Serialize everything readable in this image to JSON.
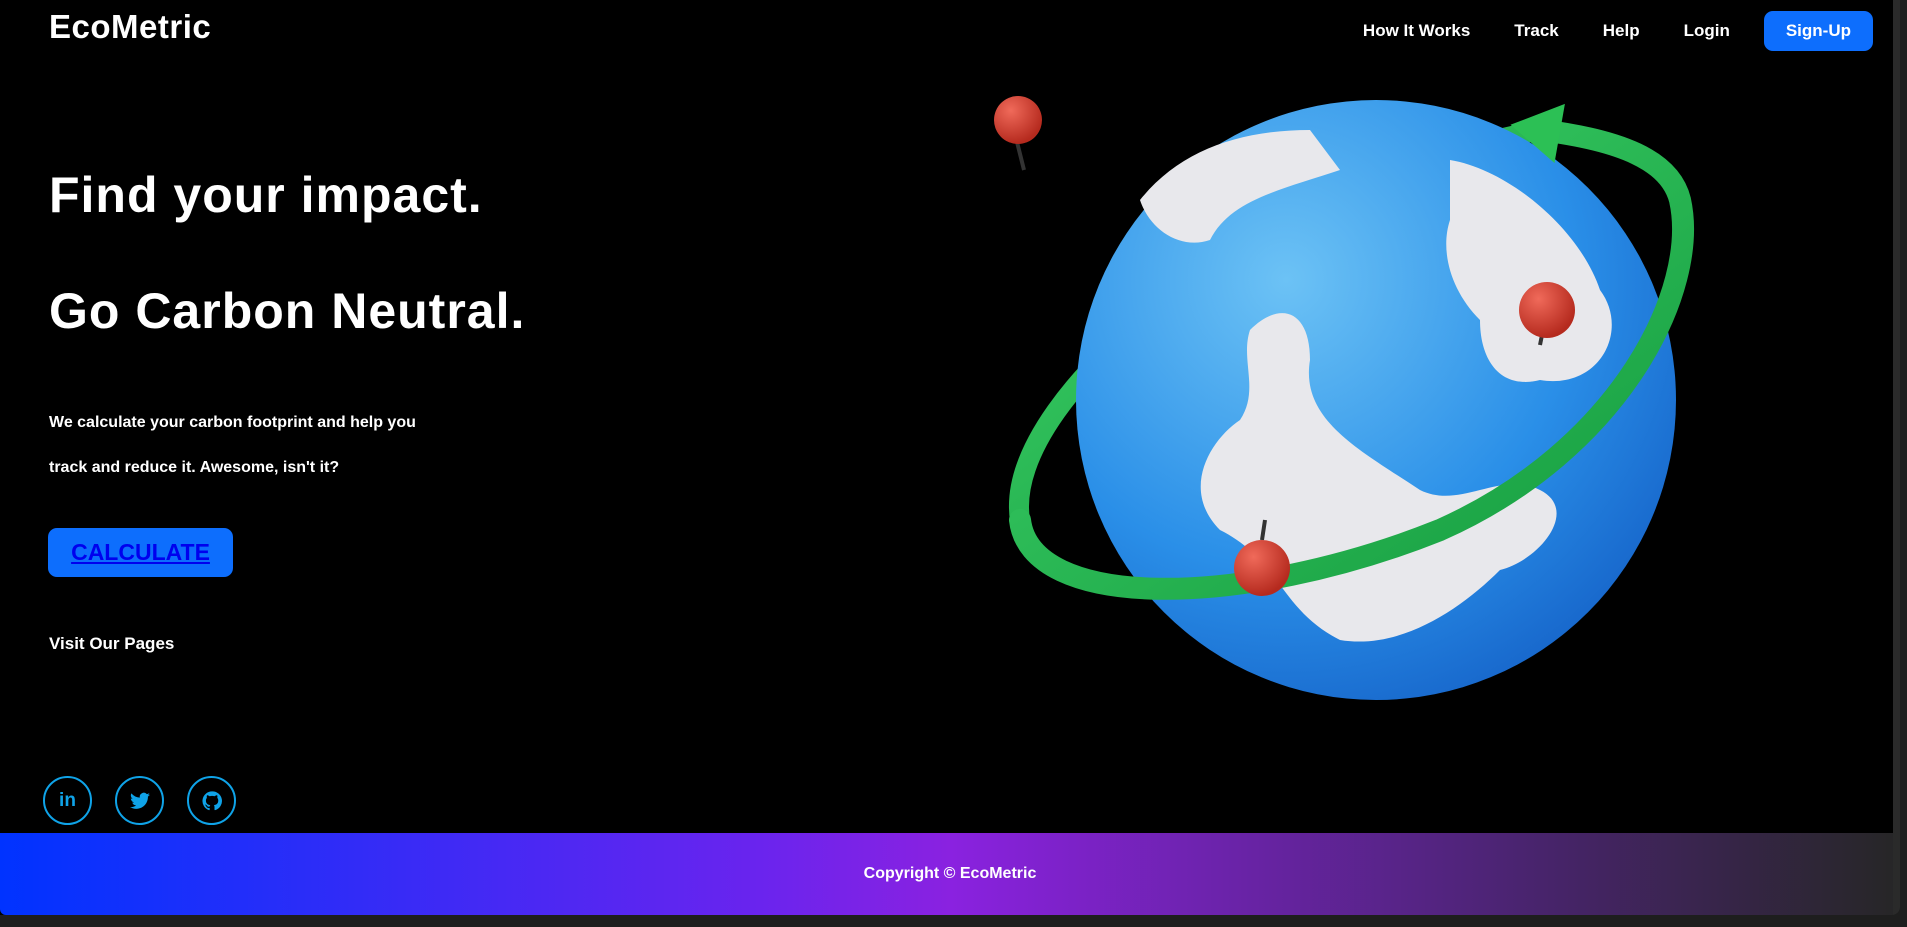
{
  "header": {
    "logo": "EcoMetric",
    "nav": [
      "How It Works",
      "Track",
      "Help",
      "Login"
    ],
    "signup": "Sign-Up"
  },
  "hero": {
    "line1": "Find your impact.",
    "line2": "Go Carbon Neutral.",
    "para1": "We calculate your carbon footprint and help you",
    "para2": "track and reduce it. Awesome, isn't it?",
    "cta": "CALCULATE",
    "visit": "Visit Our Pages"
  },
  "social": [
    {
      "icon": "linkedin-icon",
      "glyph": "in"
    },
    {
      "icon": "twitter-icon",
      "glyph": "🐦"
    },
    {
      "icon": "github-icon",
      "glyph": "◉"
    }
  ],
  "footer": {
    "copyright": "Copyright © EcoMetric"
  },
  "colors": {
    "accent": "#0d6efd",
    "social": "#0fa3e8",
    "ring": "#22b14c",
    "globe": "#2a8fe8"
  }
}
